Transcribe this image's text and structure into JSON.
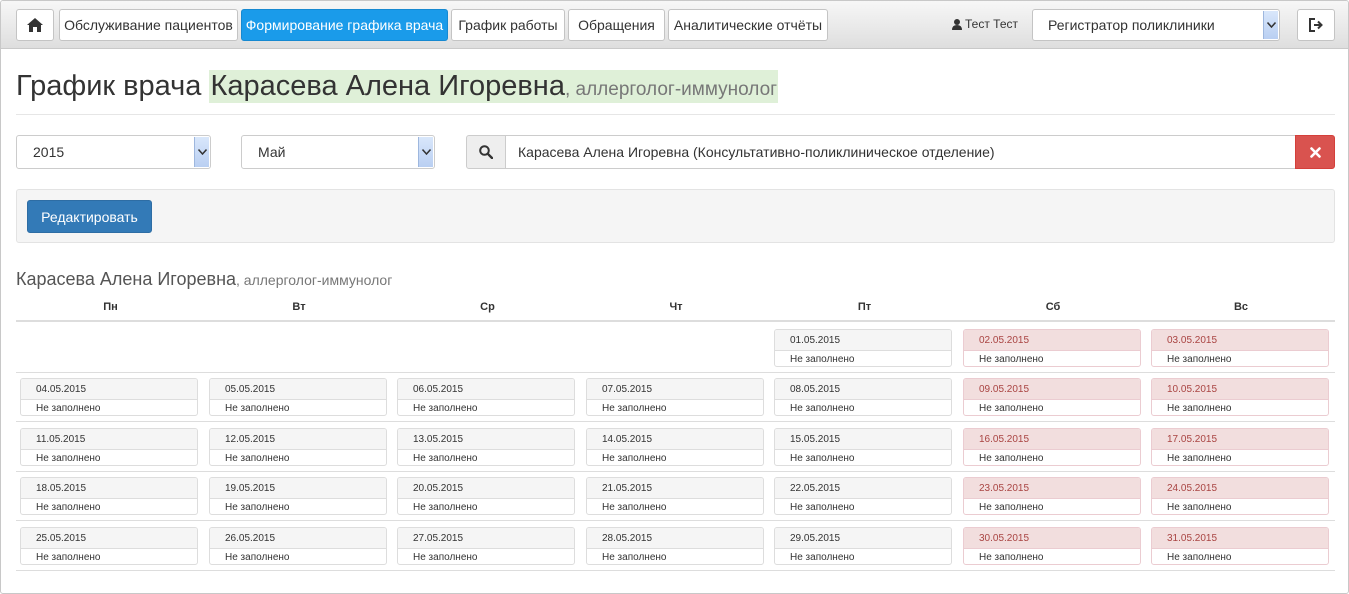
{
  "nav": {
    "home_icon": "home-icon",
    "tabs": [
      {
        "label": "Обслуживание пациентов",
        "active": false
      },
      {
        "label": "Формирование графика врача",
        "active": true
      },
      {
        "label": "График работы",
        "active": false
      },
      {
        "label": "Обращения",
        "active": false
      },
      {
        "label": "Аналитические отчёты",
        "active": false
      }
    ],
    "user_name": "Тест Тест",
    "role": "Регистратор поликлиники",
    "logout_icon": "logout-icon",
    "active_color": "#1a9bea"
  },
  "title": {
    "prefix": "График врача ",
    "doctor": "Карасева Алена Игоревна",
    "specialty": ", аллерголог-иммунолог"
  },
  "filters": {
    "year": "2015",
    "month": "Май",
    "doctor_search": "Карасева Алена Игоревна (Консультативно-поликлиническое отделение)"
  },
  "actions": {
    "edit_label": "Редактировать"
  },
  "schedule": {
    "doctor": "Карасева Алена Игоревна",
    "specialty": ", аллерголог-иммунолог",
    "days": [
      "Пн",
      "Вт",
      "Ср",
      "Чт",
      "Пт",
      "Сб",
      "Вс"
    ],
    "weekend_color": "#f2dede",
    "weeks": [
      [
        null,
        null,
        null,
        null,
        {
          "date": "01.05.2015",
          "status": "Не заполнено"
        },
        {
          "date": "02.05.2015",
          "status": "Не заполнено"
        },
        {
          "date": "03.05.2015",
          "status": "Не заполнено"
        }
      ],
      [
        {
          "date": "04.05.2015",
          "status": "Не заполнено"
        },
        {
          "date": "05.05.2015",
          "status": "Не заполнено"
        },
        {
          "date": "06.05.2015",
          "status": "Не заполнено"
        },
        {
          "date": "07.05.2015",
          "status": "Не заполнено"
        },
        {
          "date": "08.05.2015",
          "status": "Не заполнено"
        },
        {
          "date": "09.05.2015",
          "status": "Не заполнено"
        },
        {
          "date": "10.05.2015",
          "status": "Не заполнено"
        }
      ],
      [
        {
          "date": "11.05.2015",
          "status": "Не заполнено"
        },
        {
          "date": "12.05.2015",
          "status": "Не заполнено"
        },
        {
          "date": "13.05.2015",
          "status": "Не заполнено"
        },
        {
          "date": "14.05.2015",
          "status": "Не заполнено"
        },
        {
          "date": "15.05.2015",
          "status": "Не заполнено"
        },
        {
          "date": "16.05.2015",
          "status": "Не заполнено"
        },
        {
          "date": "17.05.2015",
          "status": "Не заполнено"
        }
      ],
      [
        {
          "date": "18.05.2015",
          "status": "Не заполнено"
        },
        {
          "date": "19.05.2015",
          "status": "Не заполнено"
        },
        {
          "date": "20.05.2015",
          "status": "Не заполнено"
        },
        {
          "date": "21.05.2015",
          "status": "Не заполнено"
        },
        {
          "date": "22.05.2015",
          "status": "Не заполнено"
        },
        {
          "date": "23.05.2015",
          "status": "Не заполнено"
        },
        {
          "date": "24.05.2015",
          "status": "Не заполнено"
        }
      ],
      [
        {
          "date": "25.05.2015",
          "status": "Не заполнено"
        },
        {
          "date": "26.05.2015",
          "status": "Не заполнено"
        },
        {
          "date": "27.05.2015",
          "status": "Не заполнено"
        },
        {
          "date": "28.05.2015",
          "status": "Не заполнено"
        },
        {
          "date": "29.05.2015",
          "status": "Не заполнено"
        },
        {
          "date": "30.05.2015",
          "status": "Не заполнено"
        },
        {
          "date": "31.05.2015",
          "status": "Не заполнено"
        }
      ]
    ]
  }
}
